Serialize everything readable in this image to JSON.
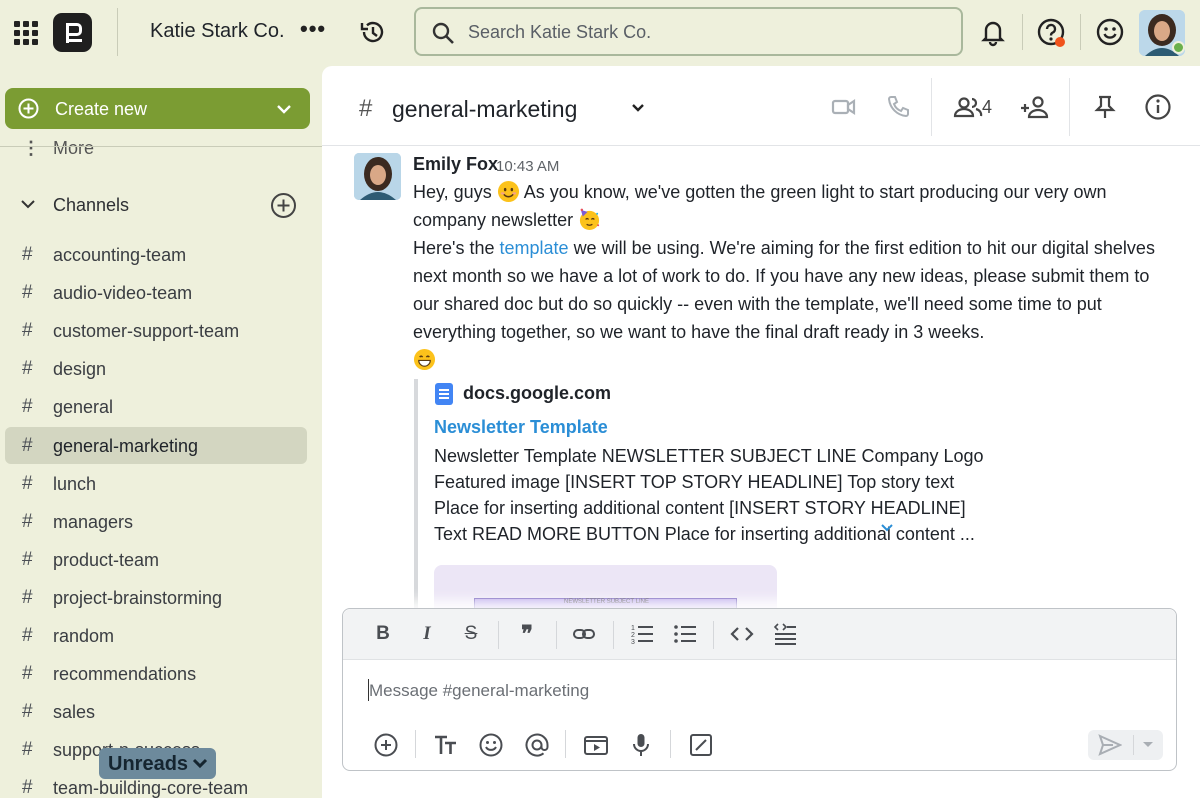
{
  "app": {
    "team_name": "Katie Stark Co.",
    "search_placeholder": "Search Katie Stark Co."
  },
  "sidebar": {
    "create_new": "Create new",
    "more": "More",
    "channels_header": "Channels",
    "channels": [
      {
        "name": "accounting-team",
        "active": false
      },
      {
        "name": "audio-video-team",
        "active": false
      },
      {
        "name": "customer-support-team",
        "active": false
      },
      {
        "name": "design",
        "active": false
      },
      {
        "name": "general",
        "active": false
      },
      {
        "name": "general-marketing",
        "active": true
      },
      {
        "name": "lunch",
        "active": false
      },
      {
        "name": "managers",
        "active": false
      },
      {
        "name": "product-team",
        "active": false
      },
      {
        "name": "project-brainstorming",
        "active": false
      },
      {
        "name": "random",
        "active": false
      },
      {
        "name": "recommendations",
        "active": false
      },
      {
        "name": "sales",
        "active": false
      },
      {
        "name": "support-n-success",
        "active": false
      },
      {
        "name": "team-building-core-team",
        "active": false
      }
    ],
    "unreads_label": "Unreads"
  },
  "channel": {
    "name": "general-marketing",
    "member_count": "4"
  },
  "message": {
    "author": "Emily Fox",
    "time": "10:43 AM",
    "line1_a": "Hey, guys",
    "line1_b": "As you know, we've gotten the green light to start producing our very own company newsletter",
    "line2_a": "Here's the",
    "link_text": "template",
    "line2_b": "we will be using. We're aiming for the first edition to hit our digital shelves next month so we have a lot of work to do. If you have any new ideas, please submit them to our shared doc but do so quickly -- even with the template, we'll need some time to put everything together, so we want to have the final draft ready in 3 weeks.",
    "preview": {
      "site": "docs.google.com",
      "title": "Newsletter Template",
      "description": "Newsletter Template NEWSLETTER SUBJECT LINE Company Logo Featured image [INSERT TOP STORY HEADLINE] Top story text Place for inserting additional content [INSERT STORY HEADLINE] Text READ MORE BUTTON Place for inserting additional content ...",
      "thumb_text": "NEWSLETTER SUBJECT LINE"
    }
  },
  "composer": {
    "placeholder": "Message #general-marketing"
  },
  "colors": {
    "accent_green": "#7b9c33",
    "link_blue": "#2b8ed6",
    "sidebar_bg": "#eef0dc",
    "alert_orange": "#f0531c",
    "online_green": "#6ab04c"
  }
}
